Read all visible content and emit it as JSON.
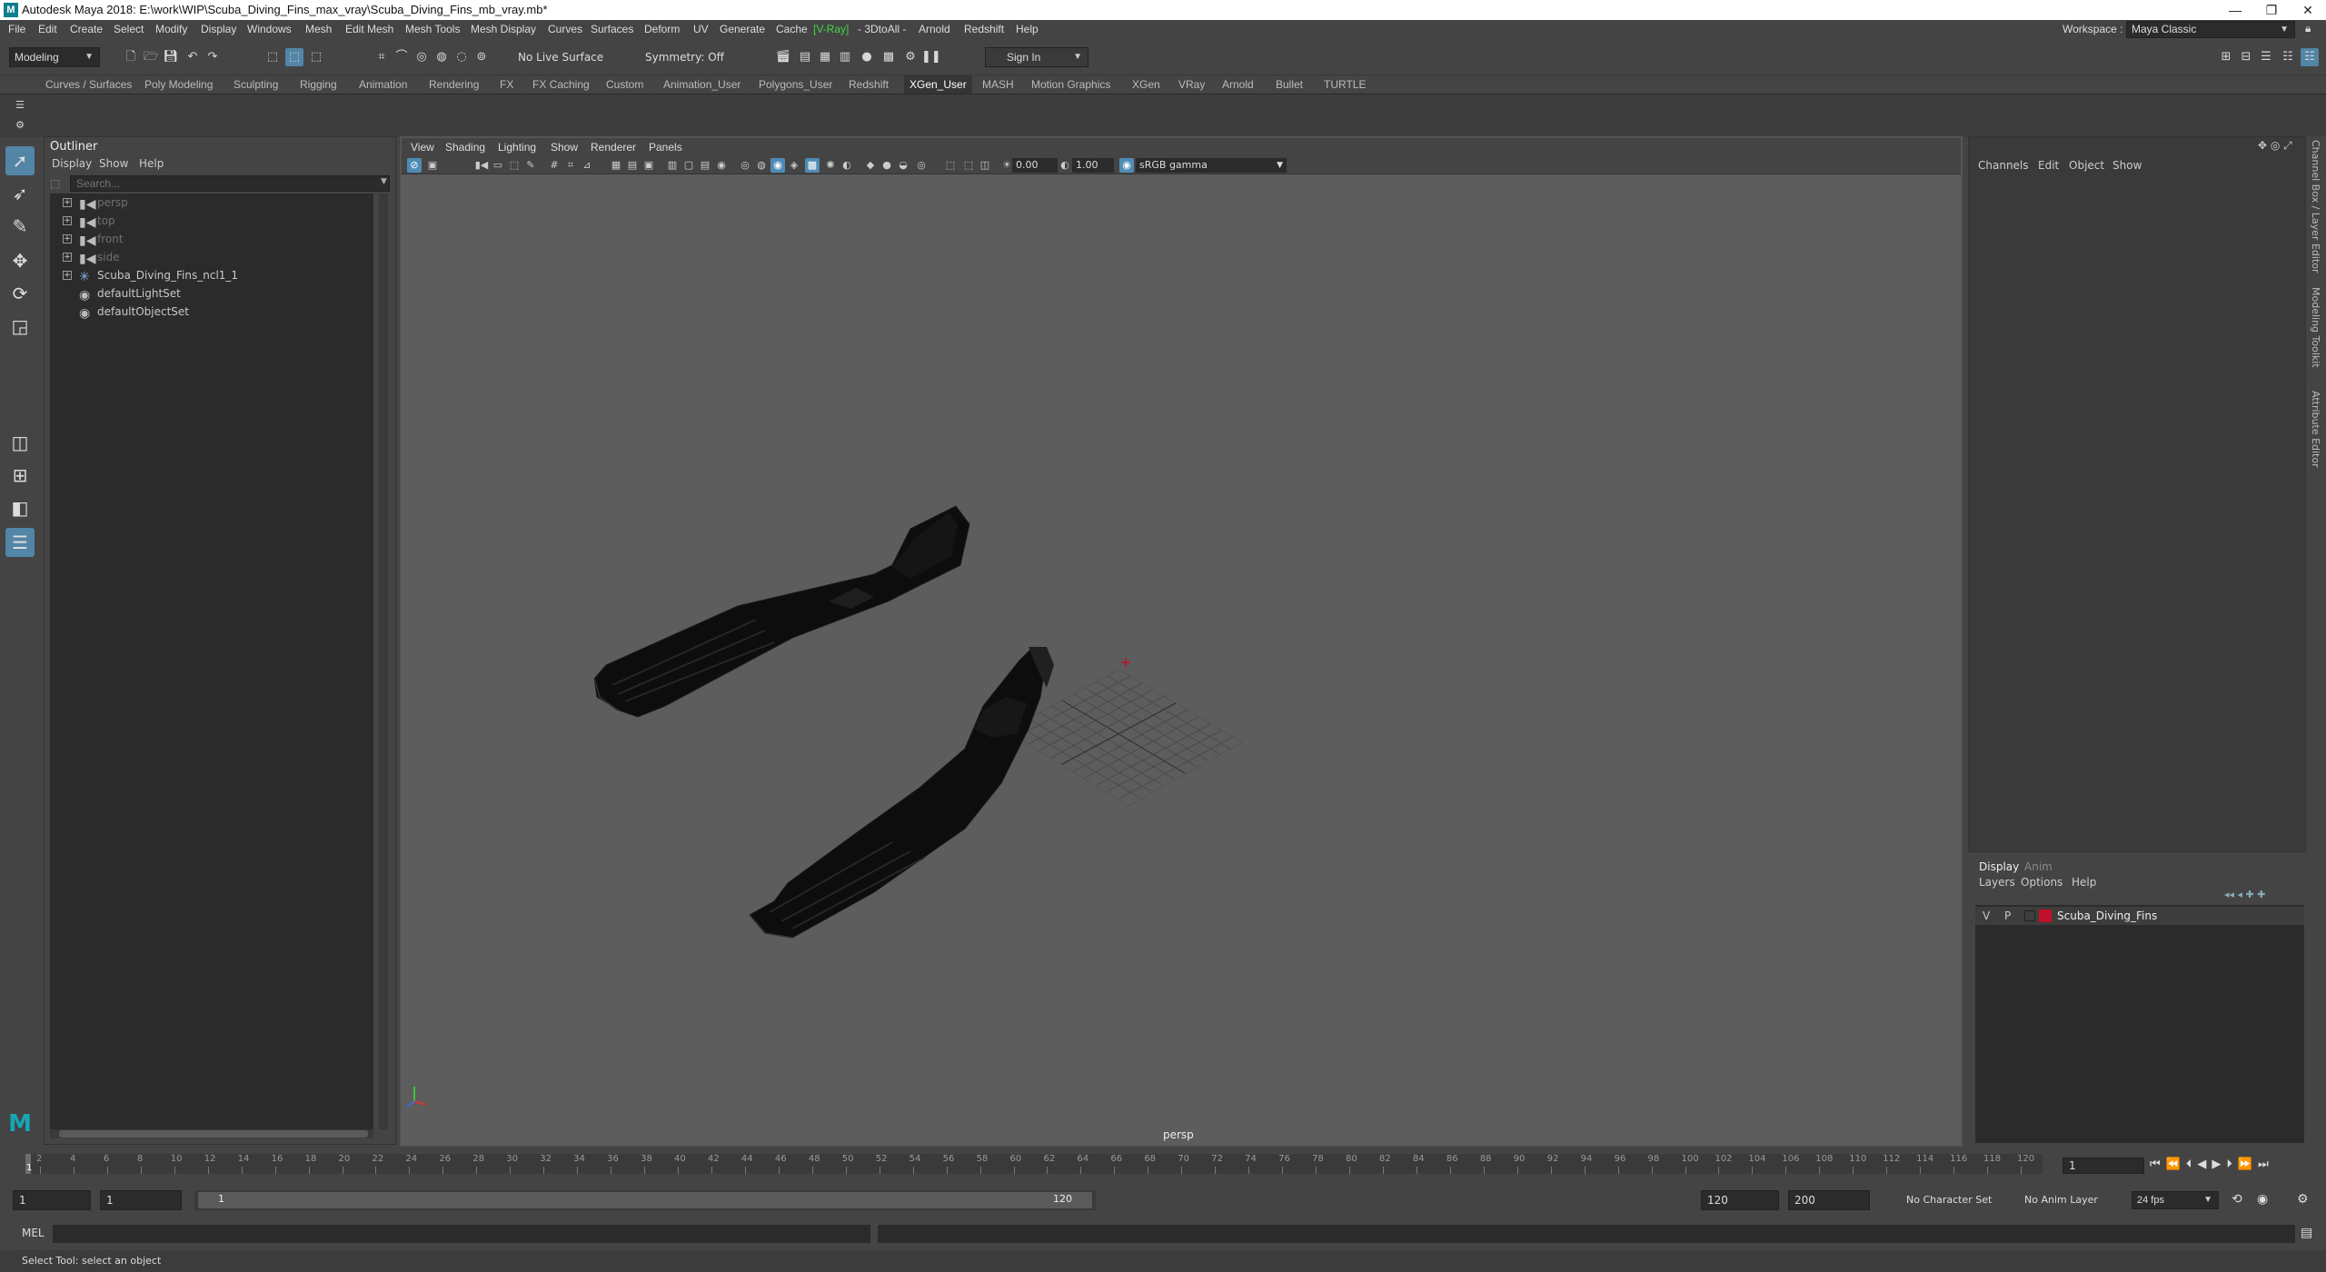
{
  "title_bar": {
    "text": "Autodesk Maya 2018: E:\\work\\WIP\\Scuba_Diving_Fins_max_vray\\Scuba_Diving_Fins_mb_vray.mb*",
    "logo": "M"
  },
  "menus": [
    "File",
    "Edit",
    "Create",
    "Select",
    "Modify",
    "Display",
    "Windows",
    "Mesh",
    "Edit Mesh",
    "Mesh Tools",
    "Mesh Display",
    "Curves",
    "Surfaces",
    "Deform",
    "UV",
    "Generate",
    "Cache",
    "V-Ray",
    "3DtoAll",
    "Arnold",
    "Redshift",
    "Help"
  ],
  "workspace": {
    "label": "Workspace :",
    "value": "Maya Classic"
  },
  "status_line": {
    "mode": "Modeling",
    "live_surface": "No Live Surface",
    "symmetry": "Symmetry: Off",
    "sign_in": "Sign In"
  },
  "shelf_tabs": [
    "Curves / Surfaces",
    "Poly Modeling",
    "Sculpting",
    "Rigging",
    "Animation",
    "Rendering",
    "FX",
    "FX Caching",
    "Custom",
    "Animation_User",
    "Polygons_User",
    "Redshift",
    "XGen_User",
    "MASH",
    "Motion Graphics",
    "XGen",
    "VRay",
    "Arnold",
    "Bullet",
    "TURTLE"
  ],
  "active_shelf_tab": "XGen_User",
  "outliner": {
    "title": "Outliner",
    "menu": [
      "Display",
      "Show",
      "Help"
    ],
    "search_placeholder": "Search...",
    "items": [
      {
        "label": "persp",
        "type": "camera",
        "dim": true
      },
      {
        "label": "top",
        "type": "camera",
        "dim": true
      },
      {
        "label": "front",
        "type": "camera",
        "dim": true
      },
      {
        "label": "side",
        "type": "camera",
        "dim": true
      },
      {
        "label": "Scuba_Diving_Fins_ncl1_1",
        "type": "group",
        "dim": false
      },
      {
        "label": "defaultLightSet",
        "type": "set",
        "dim": false
      },
      {
        "label": "defaultObjectSet",
        "type": "set",
        "dim": false
      }
    ]
  },
  "viewport": {
    "menu": [
      "View",
      "Shading",
      "Lighting",
      "Show",
      "Renderer",
      "Panels"
    ],
    "exposure": "0.00",
    "gamma": "1.00",
    "color_space": "sRGB gamma",
    "camera": "persp"
  },
  "channel_box": {
    "menu": [
      "Channels",
      "Edit",
      "Object",
      "Show"
    ]
  },
  "layer_editor": {
    "tabs": [
      "Display",
      "Anim"
    ],
    "menu": [
      "Layers",
      "Options",
      "Help"
    ],
    "layer": {
      "v": "V",
      "p": "P",
      "name": "Scuba_Diving_Fins",
      "color": "#c0102a"
    }
  },
  "side_tabs": [
    "Channel Box / Layer Editor",
    "Modeling Toolkit",
    "Attribute Editor"
  ],
  "timeline": {
    "ticks": [
      "2",
      "4",
      "6",
      "8",
      "10",
      "12",
      "14",
      "16",
      "18",
      "20",
      "22",
      "24",
      "26",
      "28",
      "30",
      "32",
      "34",
      "36",
      "38",
      "40",
      "42",
      "44",
      "46",
      "48",
      "50",
      "52",
      "54",
      "56",
      "58",
      "60",
      "62",
      "64",
      "66",
      "68",
      "70",
      "72",
      "74",
      "76",
      "78",
      "80",
      "82",
      "84",
      "86",
      "88",
      "90",
      "92",
      "94",
      "96",
      "98",
      "100",
      "102",
      "104",
      "106",
      "108",
      "110",
      "112",
      "114",
      "116",
      "118",
      "120"
    ],
    "current_frame_marker": "1",
    "current_frame": "1"
  },
  "range": {
    "start": "1",
    "playback_start": "1",
    "slider_start": "1",
    "slider_end": "120",
    "playback_end": "120",
    "end": "200",
    "character_set": "No Character Set",
    "anim_layer": "No Anim Layer",
    "fps": "24 fps"
  },
  "command_line": {
    "label": "MEL"
  },
  "help_line": "Select Tool: select an object"
}
